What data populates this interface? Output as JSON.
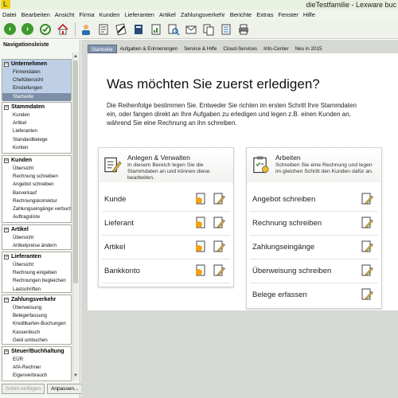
{
  "window": {
    "title": "dieTestfamilie - Lexware buc"
  },
  "menu": [
    "Datei",
    "Bearbeiten",
    "Ansicht",
    "Firma",
    "Kunden",
    "Lieferanten",
    "Artikel",
    "Zahlungsverkehr",
    "Berichte",
    "Extras",
    "Fenster",
    "Hilfe"
  ],
  "toolbar": {
    "icons": [
      "back-icon",
      "forward-icon",
      "refresh-icon",
      "home-icon",
      "customer-icon",
      "document-icon",
      "invoice-icon",
      "book-icon",
      "report-icon",
      "search-document-icon",
      "mail-icon",
      "copy-icon",
      "list-icon",
      "print-icon"
    ]
  },
  "sidebar": {
    "title": "Navigationsleiste",
    "sections": [
      {
        "title": "Unternehmen",
        "active": true,
        "items": [
          "Firmendaten",
          "Chefübersicht",
          "Einstellungen",
          "Startseite"
        ]
      },
      {
        "title": "Stammdaten",
        "items": [
          "Kunden",
          "Artikel",
          "Lieferanten",
          "Standardbelege",
          "Konten"
        ]
      },
      {
        "title": "Kunden",
        "items": [
          "Übersicht",
          "Rechnung schreiben",
          "Angebot schreiben",
          "Barverkauf",
          "Rechnungskorrektur",
          "Zahlungseingänge verbuchen",
          "Auftragsliste"
        ]
      },
      {
        "title": "Artikel",
        "items": [
          "Übersicht",
          "Artikelpreise ändern"
        ]
      },
      {
        "title": "Lieferanten",
        "items": [
          "Übersicht",
          "Rechnung eingeben",
          "Rechnungen begleichen",
          "Lastschriften"
        ]
      },
      {
        "title": "Zahlungsverkehr",
        "items": [
          "Überweisung",
          "Belegerfassung",
          "Kreditkarten-Buchungen",
          "Kassenbuch",
          "Geld umbuchen"
        ]
      },
      {
        "title": "Steuer/Buchhaltung",
        "items": [
          "EÜR",
          "AfA-Rechner",
          "Eigenverbrauch"
        ]
      }
    ],
    "selected": "Startseite",
    "footer": {
      "left_button": "Sofort einfügen",
      "right_button": "Anpassen..."
    }
  },
  "tabs": [
    "Startseite",
    "Aufgaben & Erinnerungen",
    "Service & Hilfe",
    "Cloud-Services",
    "Info-Center",
    "Neu in 2015"
  ],
  "active_tab": "Startseite",
  "hero": {
    "title": "Was möchten Sie zuerst erledigen?",
    "description": "Die Reihenfolge bestimmen Sie. Entweder Sie richten im ersten Schritt Ihre Stammdaten ein, oder fangen direkt an Ihre Aufgaben zu erledigen und legen z.B. einen Kunden an, während Sie eine Rechnung an ihn schreiben."
  },
  "panels": {
    "left": {
      "title": "Anlegen & Verwalten",
      "description": "In diesem Bereich legen Sie die Stammdaten an und können diese bearbeiten.",
      "rows": [
        "Kunde",
        "Lieferant",
        "Artikel",
        "Bankkonto"
      ]
    },
    "right": {
      "title": "Arbeiten",
      "description": "Schreiben Sie eine Rechnung und legen im gleichen Schritt den Kunden dafür an.",
      "rows": [
        "Angebot schreiben",
        "Rechnung schreiben",
        "Zahlungseingänge",
        "Überweisung schreiben",
        "Belege erfassen"
      ]
    }
  }
}
